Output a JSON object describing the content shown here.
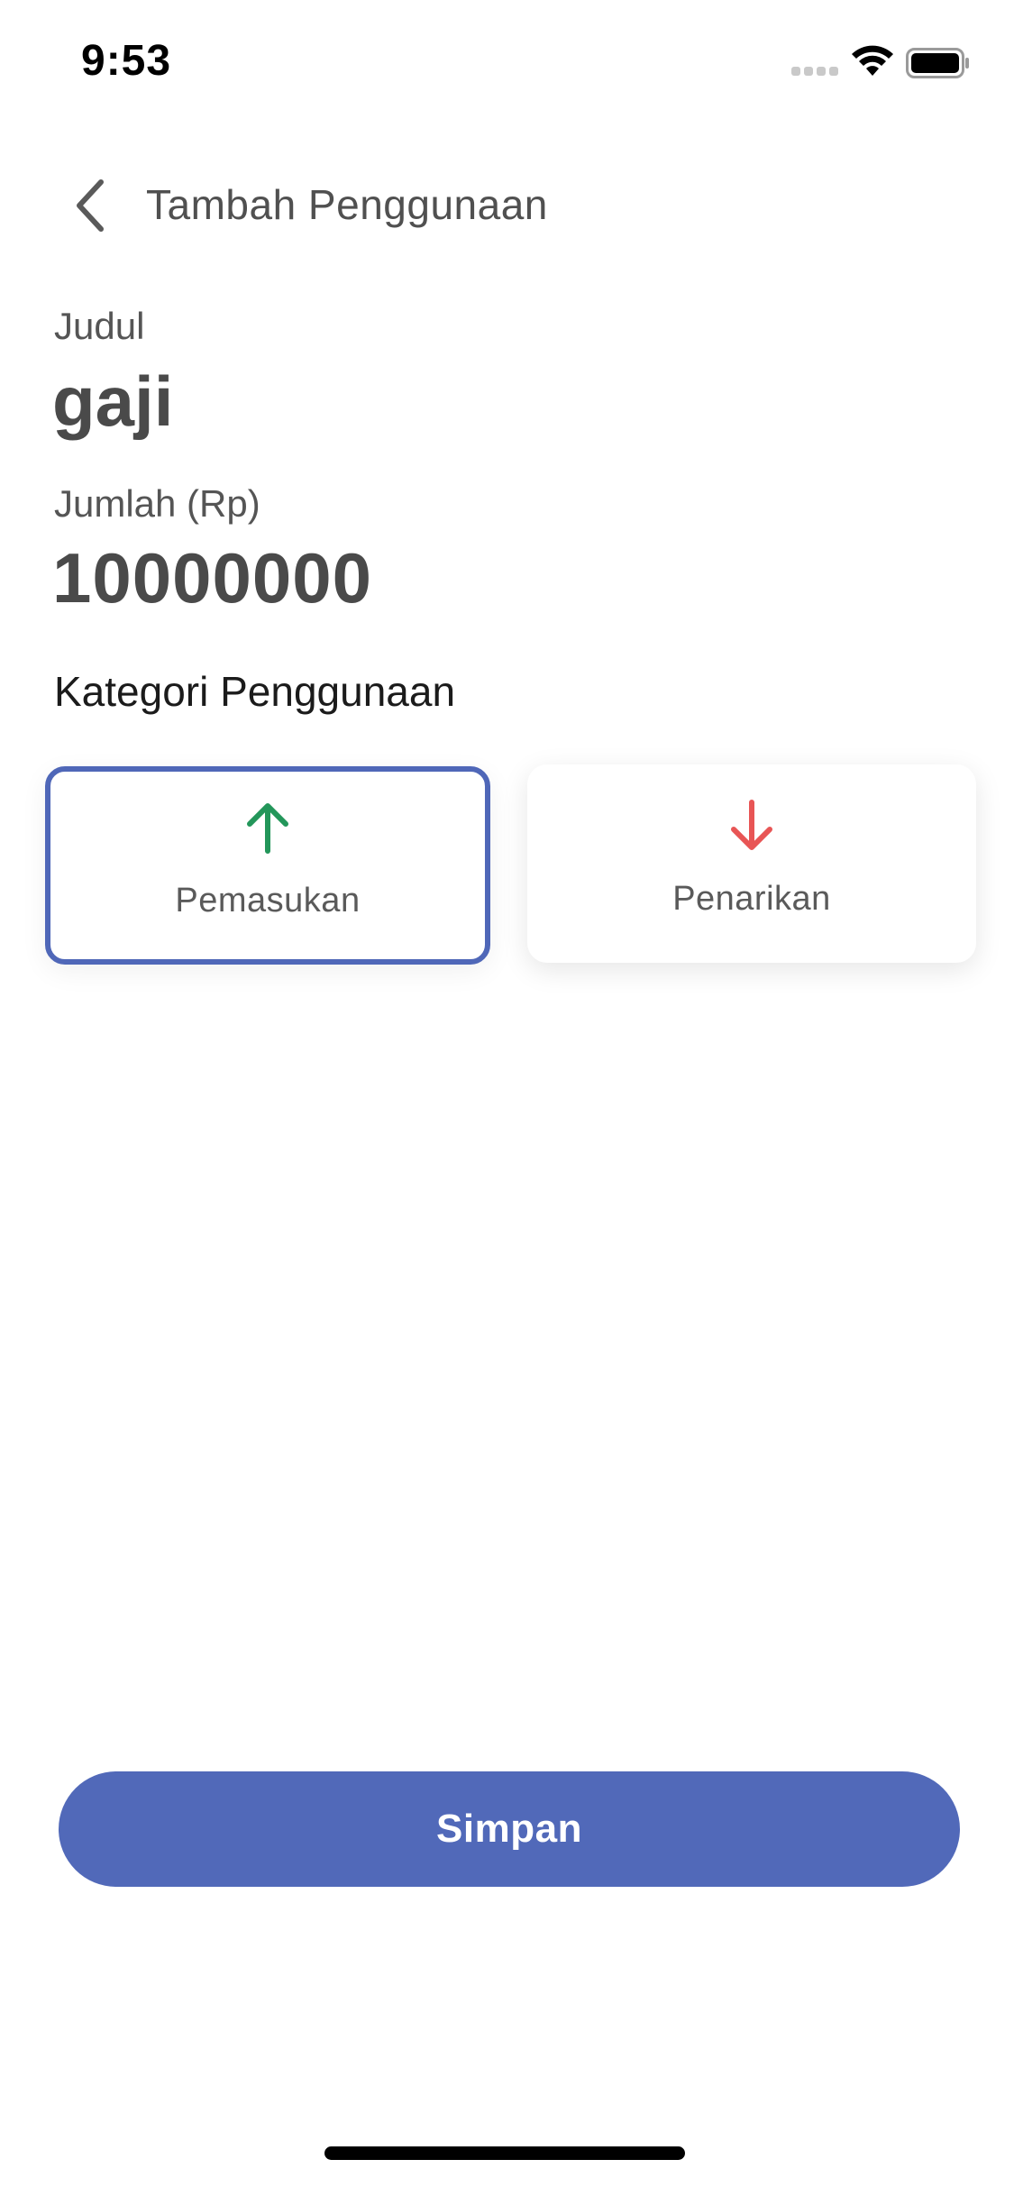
{
  "status_bar": {
    "time": "9:53",
    "icons": [
      "signal-dots-icon",
      "wifi-icon",
      "battery-icon"
    ]
  },
  "header": {
    "back_icon": "chevron-left-icon",
    "title": "Tambah Penggunaan"
  },
  "form": {
    "judul": {
      "label": "Judul",
      "value": "gaji"
    },
    "jumlah": {
      "label": "Jumlah (Rp)",
      "value": "10000000"
    }
  },
  "kategori": {
    "title": "Kategori Penggunaan",
    "options": [
      {
        "label": "Pemasukan",
        "icon": "arrow-up-icon",
        "color": "#23965a",
        "selected": true
      },
      {
        "label": "Penarikan",
        "icon": "arrow-down-icon",
        "color": "#e85555",
        "selected": false
      }
    ]
  },
  "actions": {
    "save_label": "Simpan"
  },
  "colors": {
    "accent": "#5169b9",
    "selected_border": "#4f67b8",
    "income": "#23965a",
    "withdrawal": "#e85555"
  }
}
